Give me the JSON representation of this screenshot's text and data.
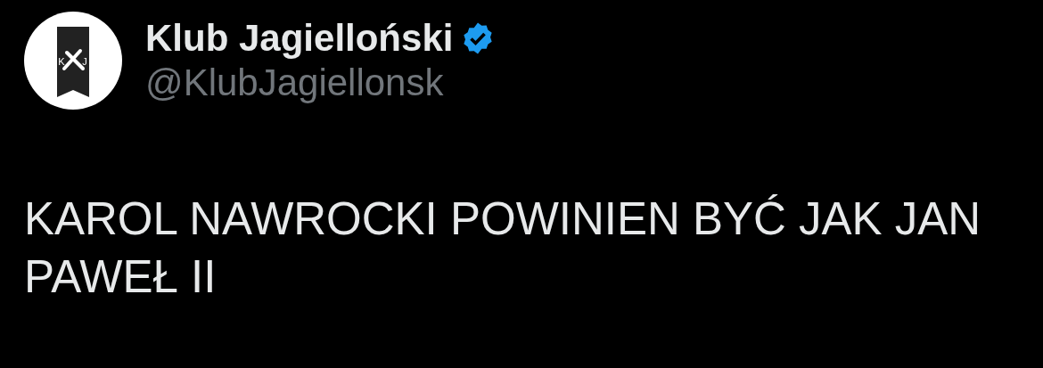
{
  "author": {
    "avatar_letters": [
      "K",
      "J"
    ],
    "name": "Klub Jagielloński",
    "verified": true,
    "handle": "@KlubJagiellonsk"
  },
  "tweet": {
    "text": "KAROL NAWROCKI POWINIEN BYĆ JAK JAN PAWEŁ II"
  }
}
